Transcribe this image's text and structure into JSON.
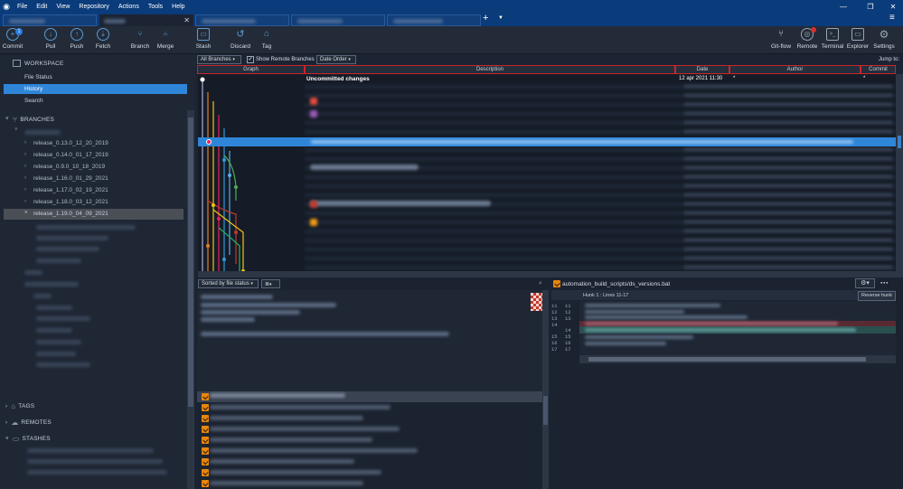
{
  "menu": [
    "File",
    "Edit",
    "View",
    "Repository",
    "Actions",
    "Tools",
    "Help"
  ],
  "toolbar": {
    "left": [
      {
        "label": "Commit",
        "icon": "commit-icon",
        "badge": "1"
      },
      {
        "label": "Pull",
        "icon": "pull-icon"
      },
      {
        "label": "Push",
        "icon": "push-icon"
      },
      {
        "label": "Fetch",
        "icon": "fetch-icon"
      },
      {
        "label": "Branch",
        "icon": "branch-icon"
      },
      {
        "label": "Merge",
        "icon": "merge-icon"
      },
      {
        "label": "Stash",
        "icon": "stash-icon"
      },
      {
        "label": "Discard",
        "icon": "discard-icon"
      },
      {
        "label": "Tag",
        "icon": "tag-icon"
      }
    ],
    "right": [
      {
        "label": "Git-flow",
        "icon": "gitflow-icon"
      },
      {
        "label": "Remote",
        "icon": "remote-icon"
      },
      {
        "label": "Terminal",
        "icon": "terminal-icon"
      },
      {
        "label": "Explorer",
        "icon": "explorer-icon"
      },
      {
        "label": "Settings",
        "icon": "settings-icon"
      }
    ]
  },
  "sidebar": {
    "workspace": "WORKSPACE",
    "items": [
      "File Status",
      "History",
      "Search"
    ],
    "branches_header": "BRANCHES",
    "branches": [
      "release_0.13.0_12_20_2019",
      "release_0.14.0_01_17_2019",
      "release_0.9.0_10_18_2019",
      "release_1.16.0_01_29_2021",
      "release_1.17.0_02_19_2021",
      "release_1.18.0_03_12_2021",
      "release_1.19.0_04_09_2021"
    ],
    "tags": "TAGS",
    "remotes": "REMOTES",
    "stashes": "STASHES"
  },
  "filters": {
    "branches": "All Branches",
    "show_remote": "Show Remote Branches",
    "order": "Date Order",
    "jump": "Jump to:"
  },
  "columns": [
    "Graph",
    "Description",
    "Date",
    "Author",
    "Commit"
  ],
  "uncommitted": {
    "description": "Uncommitted changes",
    "date": "12 apr 2021 11:30",
    "author": "*",
    "commit": "*"
  },
  "lower": {
    "sort": "Sorted by file status",
    "file": "automation_build_scripts/ds_versions.bat",
    "hunk": "Hunk 1 : Lines 11-17",
    "reverse": "Reverse hunk",
    "old_lines": [
      "11",
      "12",
      "13",
      "14",
      "15",
      "16",
      "17"
    ],
    "new_lines": [
      "11",
      "12",
      "13",
      "",
      "14",
      "15",
      "16",
      "17"
    ]
  },
  "colors": {
    "accent": "#2f86d9",
    "titlebar": "#0a3b7a",
    "diff_removed": "#5a2a33",
    "diff_added": "#2a4f4f"
  }
}
